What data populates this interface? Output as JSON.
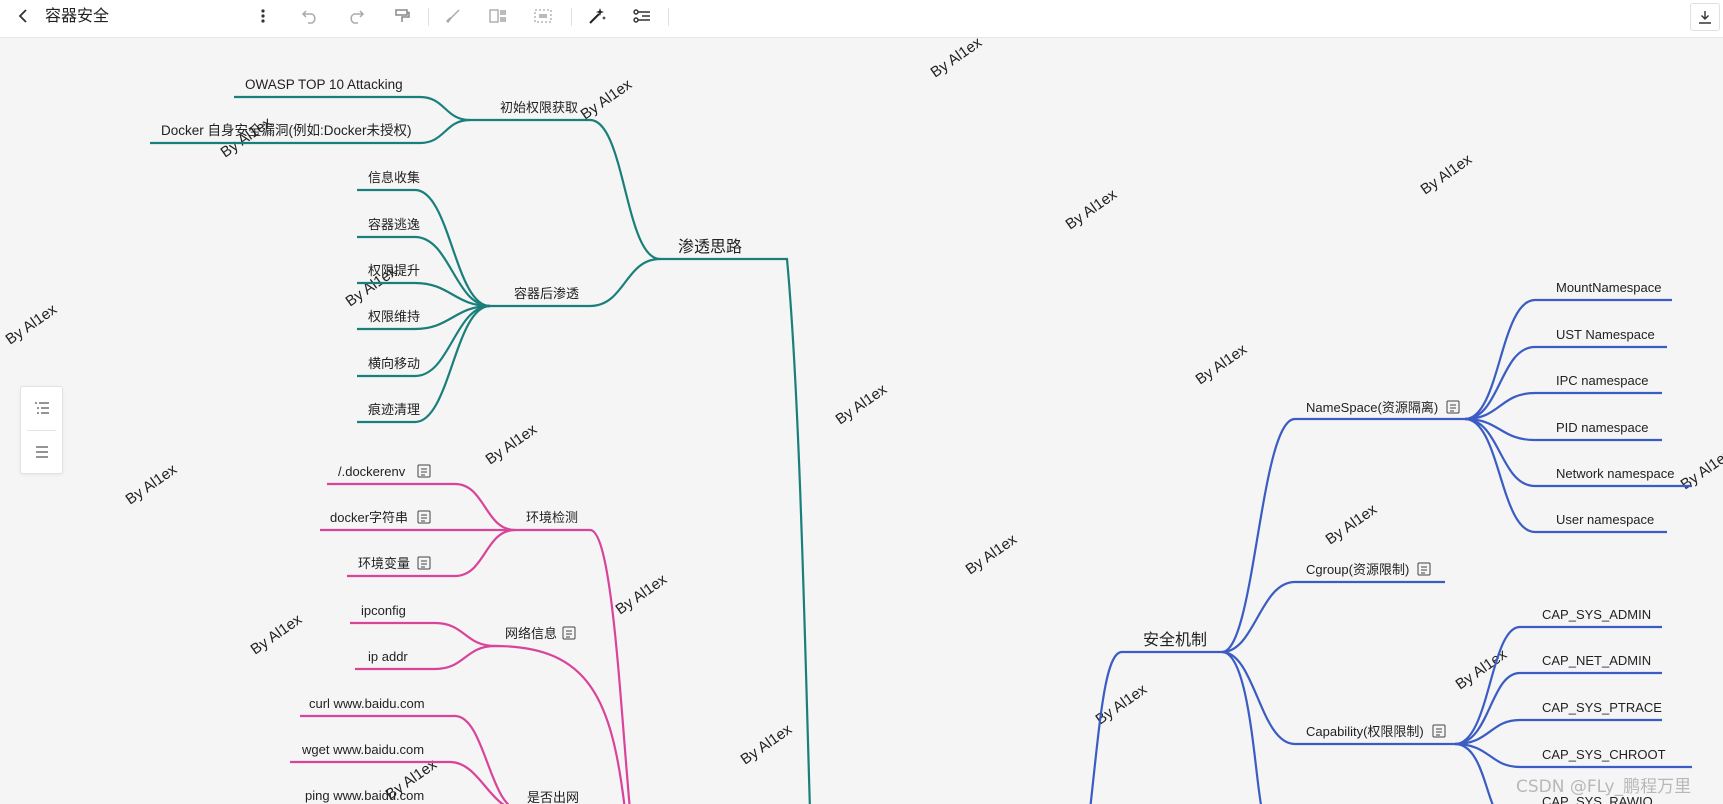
{
  "document": {
    "title": "容器安全"
  },
  "toolbar": {
    "buttons": [
      "back",
      "more",
      "undo",
      "redo",
      "format-painter",
      "brush",
      "layout",
      "select-area",
      "ai-magic",
      "structure",
      "download"
    ]
  },
  "outline_panel": {
    "buttons": [
      "outline-view",
      "list-view"
    ]
  },
  "mindmap": {
    "root_pentest": "渗透思路",
    "initial_access": {
      "label": "初始权限获取",
      "children": [
        "OWASP TOP 10 Attacking",
        "Docker 自身安全漏洞(例如:Docker未授权)"
      ]
    },
    "post_exploit": {
      "label": "容器后渗透",
      "children": [
        "信息收集",
        "容器逃逸",
        "权限提升",
        "权限维持",
        "横向移动",
        "痕迹清理"
      ]
    },
    "env_check": {
      "label": "环境检测",
      "children": [
        "/.dockerenv",
        "docker字符串",
        "环境变量"
      ]
    },
    "net_info": {
      "label": "网络信息",
      "children": [
        "ipconfig",
        "ip addr"
      ]
    },
    "outbound": {
      "label": "是否出网",
      "children": [
        "curl www.baidu.com",
        "wget www.baidu.com",
        "ping www.baidu.com"
      ]
    },
    "security": {
      "label": "安全机制",
      "namespace": {
        "label": "NameSpace(资源隔离)",
        "children": [
          "MountNamespace",
          "UST Namespace",
          "IPC namespace",
          "PID namespace",
          "Network namespace",
          "User namespace"
        ]
      },
      "cgroup": {
        "label": "Cgroup(资源限制)"
      },
      "capability": {
        "label": "Capability(权限限制)",
        "children": [
          "CAP_SYS_ADMIN",
          "CAP_NET_ADMIN",
          "CAP_SYS_PTRACE",
          "CAP_SYS_CHROOT",
          "CAP_SYS_RAWIO"
        ]
      }
    }
  },
  "watermark": "By Al1ex",
  "credit": "CSDN @FLy_鹏程万里",
  "colors": {
    "teal": "#1a7f7a",
    "pink": "#d9449b",
    "blue": "#3a5cc4",
    "background": "#f5f5f5"
  }
}
